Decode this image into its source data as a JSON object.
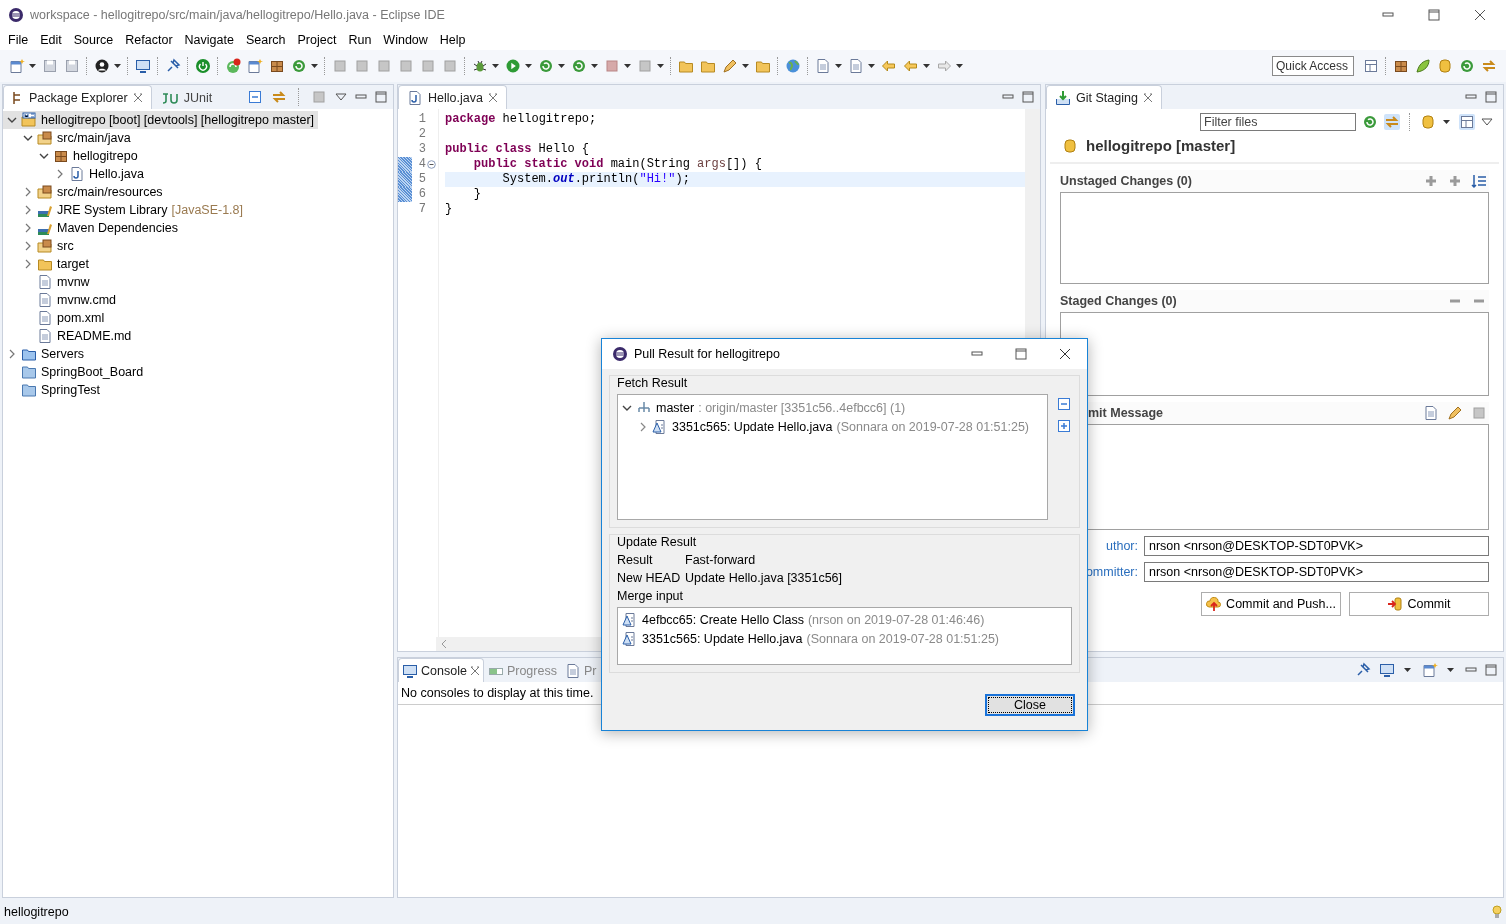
{
  "window": {
    "title": "workspace - hellogitrepo/src/main/java/hellogitrepo/Hello.java - Eclipse IDE"
  },
  "menu": [
    "File",
    "Edit",
    "Source",
    "Refactor",
    "Navigate",
    "Search",
    "Project",
    "Run",
    "Window",
    "Help"
  ],
  "quick_access": {
    "placeholder": "Quick Access"
  },
  "package_explorer": {
    "tabs": [
      {
        "label": "Package Explorer",
        "selected": true
      },
      {
        "label": "JUnit",
        "selected": false
      }
    ],
    "tree": [
      {
        "kind": "project",
        "label": "hellogitrepo [boot] [devtools] [hellogitrepo master]",
        "selected": true,
        "expanded": true,
        "children": [
          {
            "kind": "source-folder",
            "label": "src/main/java",
            "selected": false,
            "expanded": true,
            "children": [
              {
                "kind": "package",
                "label": "hellogitrepo",
                "selected": false,
                "expanded": true,
                "children": [
                  {
                    "kind": "java-file",
                    "label": "Hello.java",
                    "selected": false,
                    "expanded": false
                  }
                ]
              }
            ]
          },
          {
            "kind": "source-folder",
            "label": "src/main/resources",
            "selected": false,
            "expanded": false
          },
          {
            "kind": "library",
            "label": "JRE System Library",
            "decoration": "[JavaSE-1.8]",
            "selected": false,
            "expanded": false
          },
          {
            "kind": "library",
            "label": "Maven Dependencies",
            "selected": false,
            "expanded": false
          },
          {
            "kind": "source-folder",
            "label": "src",
            "selected": false,
            "expanded": false
          },
          {
            "kind": "folder",
            "label": "target",
            "selected": false,
            "expanded": false
          },
          {
            "kind": "file",
            "label": "mvnw",
            "selected": false
          },
          {
            "kind": "file",
            "label": "mvnw.cmd",
            "selected": false
          },
          {
            "kind": "file",
            "label": "pom.xml",
            "selected": false
          },
          {
            "kind": "file",
            "label": "README.md",
            "selected": false
          }
        ]
      },
      {
        "kind": "server-folder",
        "label": "Servers",
        "selected": false,
        "expanded": false
      },
      {
        "kind": "closed-project",
        "label": "SpringBoot_Board",
        "selected": false
      },
      {
        "kind": "closed-project",
        "label": "SpringTest",
        "selected": false
      }
    ]
  },
  "editor": {
    "tab": "Hello.java",
    "lines": [
      {
        "number": "1",
        "changed": false,
        "current": false,
        "tokens": [
          {
            "kind": "keyword",
            "text": "package"
          },
          {
            "kind": "plain",
            "text": " hellogitrepo;"
          }
        ]
      },
      {
        "number": "2",
        "changed": false,
        "current": false
      },
      {
        "number": "3",
        "changed": false,
        "current": false,
        "tokens": [
          {
            "kind": "keyword",
            "text": "public class"
          },
          {
            "kind": "plain",
            "text": " Hello {"
          }
        ]
      },
      {
        "number": "4",
        "changed": true,
        "current": false,
        "fold": true,
        "tokens": [
          {
            "kind": "keyword",
            "text": "    public static void"
          },
          {
            "kind": "plain",
            "text": " main(String "
          },
          {
            "kind": "param",
            "text": "args"
          },
          {
            "kind": "plain",
            "text": "[]) {"
          }
        ]
      },
      {
        "number": "5",
        "changed": true,
        "current": true,
        "tokens": [
          {
            "kind": "plain",
            "text": "        System."
          },
          {
            "kind": "field",
            "text": "out"
          },
          {
            "kind": "plain",
            "text": ".println("
          },
          {
            "kind": "string",
            "text": "\"Hi!\""
          },
          {
            "kind": "plain",
            "text": ");"
          }
        ]
      },
      {
        "number": "6",
        "changed": true,
        "current": false,
        "tokens": [
          {
            "kind": "plain",
            "text": "    }"
          }
        ]
      },
      {
        "number": "7",
        "changed": false,
        "current": false,
        "tokens": [
          {
            "kind": "plain",
            "text": "}"
          }
        ]
      }
    ]
  },
  "git_staging": {
    "tab": "Git Staging",
    "filter": {
      "placeholder": "Filter files"
    },
    "repository": "hellogitrepo [master]",
    "unstaged_header": "Unstaged Changes (0)",
    "staged_header": "Staged Changes (0)",
    "commit_message_header": "mit Message",
    "author": {
      "label": "uthor:",
      "value": "nrson <nrson@DESKTOP-SDT0PVK>"
    },
    "committer": {
      "label": "ommitter:",
      "value": "nrson <nrson@DESKTOP-SDT0PVK>"
    },
    "buttons": [
      "Commit and Push...",
      "Commit"
    ]
  },
  "console": {
    "tabs": [
      {
        "label": "Console",
        "selected": true
      },
      {
        "label": "Progress",
        "selected": false
      },
      {
        "label": "Pr",
        "selected": false
      }
    ],
    "message": "No consoles to display at this time."
  },
  "status_bar": {
    "text": "hellogitrepo"
  },
  "dialog": {
    "title": "Pull Result for hellogitrepo",
    "fetch_label": "Fetch Result",
    "fetch_tree": [
      {
        "label": "master",
        "detail": " : origin/master [3351c56..4efbcc6] (1)",
        "expanded": true,
        "children": [
          {
            "label": "3351c565: Update Hello.java",
            "detail": " (Sonnara on 2019-07-28 01:51:25)",
            "expanded": false
          }
        ]
      }
    ],
    "update_label": "Update Result",
    "update_rows": [
      {
        "label": "Result",
        "value": "Fast-forward"
      },
      {
        "label": "New HEAD",
        "value": "Update Hello.java [3351c56]"
      }
    ],
    "merge_label": "Merge input",
    "merge_commits": [
      {
        "label": "4efbcc65: Create Hello Class",
        "detail": " (nrson on 2019-07-28 01:46:46)"
      },
      {
        "label": "3351c565: Update Hello.java",
        "detail": " (Sonnara on 2019-07-28 01:51:25)"
      }
    ],
    "close_button": "Close"
  }
}
